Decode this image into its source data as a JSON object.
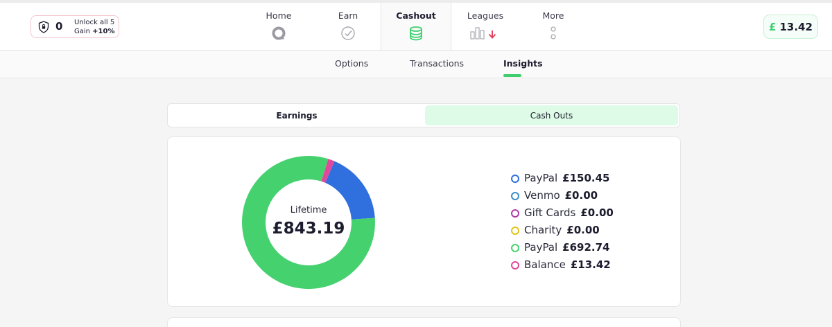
{
  "header": {
    "unlock": {
      "count": "0",
      "line1": "Unlock all 5",
      "line2_prefix": "Gain ",
      "line2_bold": "+10%",
      "icon": "shield-lock-icon"
    },
    "nav": [
      {
        "label": "Home",
        "icon": "home-circle-icon"
      },
      {
        "label": "Earn",
        "icon": "check-circle-icon"
      },
      {
        "label": "Cashout",
        "icon": "coins-stack-icon",
        "active": true
      },
      {
        "label": "Leagues",
        "icon": "bars-down-arrow-icon"
      },
      {
        "label": "More",
        "icon": "dots-vertical-icon"
      }
    ],
    "balance": {
      "currency": "£",
      "amount": "13.42"
    }
  },
  "subtabs": [
    "Options",
    "Transactions",
    "Insights"
  ],
  "active_subtab": "Insights",
  "toggle": {
    "left": "Earnings",
    "right": "Cash Outs",
    "selected": "Cash Outs"
  },
  "summary": {
    "label": "Lifetime",
    "value": "£843.19"
  },
  "colors": {
    "accent": "#3fcf6e",
    "paypal_blue": "#2f6fde",
    "venmo": "#3d8ec9",
    "gift": "#b23aa6",
    "charity": "#e5c315",
    "balance": "#e0489c"
  },
  "chart_data": {
    "type": "pie",
    "donut": true,
    "categories": [
      "PayPal",
      "Venmo",
      "Gift Cards",
      "Charity",
      "PayPal",
      "Balance"
    ],
    "values": [
      150.45,
      0.0,
      0.0,
      0.0,
      692.74,
      13.42
    ],
    "display": [
      "£150.45",
      "£0.00",
      "£0.00",
      "£0.00",
      "£692.74",
      "£13.42"
    ],
    "colors": [
      "#2f6fde",
      "#3d8ec9",
      "#b23aa6",
      "#e5c315",
      "#46d16f",
      "#e0489c"
    ]
  }
}
